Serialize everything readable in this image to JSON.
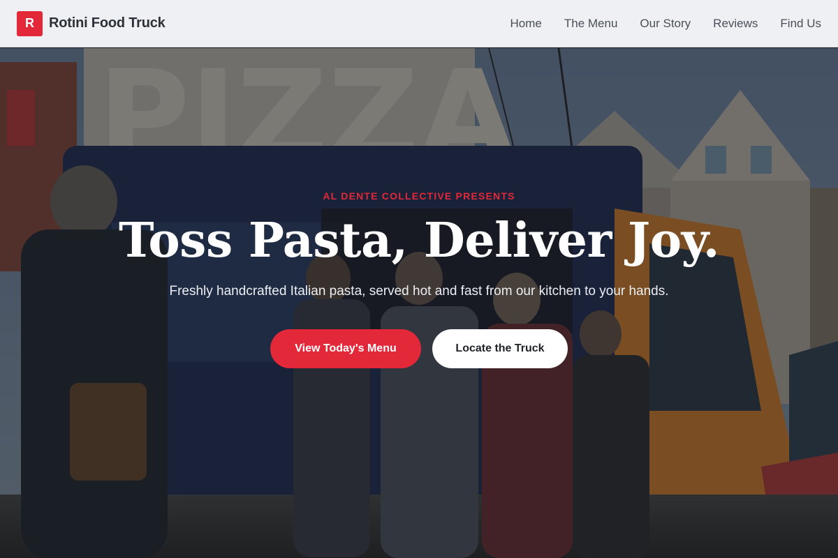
{
  "brand": {
    "logo_letter": "R",
    "name": "Rotini Food Truck"
  },
  "nav": {
    "items": [
      "Home",
      "The Menu",
      "Our Story",
      "Reviews",
      "Find Us"
    ]
  },
  "hero": {
    "eyebrow": "AL DENTE COLLECTIVE PRESENTS",
    "headline": "Toss Pasta, Deliver Joy.",
    "subhead": "Freshly handcrafted Italian pasta, served hot and fast from our kitchen to your hands.",
    "primary_cta": "View Today's Menu",
    "secondary_cta": "Locate the Truck",
    "sign_text": "PIZZA"
  },
  "colors": {
    "accent": "#e3283a",
    "header_bg": "#eef0f3",
    "truck_blue": "#1f2f55",
    "truck_orange": "#d9822b"
  }
}
